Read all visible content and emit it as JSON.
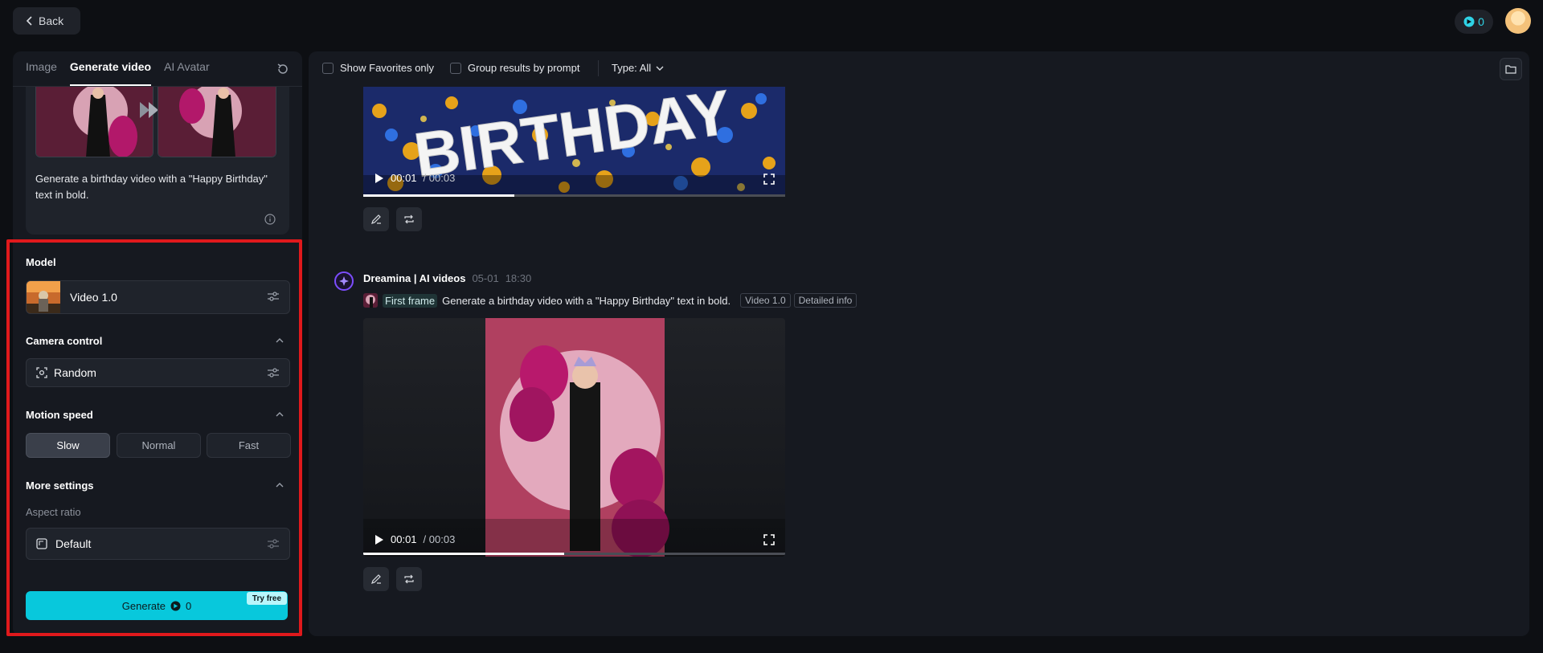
{
  "topbar": {
    "back_label": "Back",
    "credits": "0"
  },
  "tabs": [
    {
      "label": "Image"
    },
    {
      "label": "Generate video"
    },
    {
      "label": "AI Avatar"
    }
  ],
  "prompt_card": {
    "text": "Generate a birthday video with a \"Happy Birthday\" text in bold."
  },
  "model": {
    "label": "Model",
    "value": "Video 1.0"
  },
  "camera": {
    "label": "Camera control",
    "value": "Random"
  },
  "motion": {
    "label": "Motion speed",
    "options": [
      {
        "label": "Slow"
      },
      {
        "label": "Normal"
      },
      {
        "label": "Fast"
      }
    ],
    "selected": "Slow"
  },
  "more_settings": {
    "label": "More settings",
    "aspect_label": "Aspect ratio",
    "aspect_value": "Default"
  },
  "generate": {
    "label": "Generate",
    "cost": "0",
    "badge": "Try free"
  },
  "filters": {
    "favorites": "Show Favorites only",
    "group": "Group results by prompt",
    "type": "Type: All"
  },
  "video1": {
    "time": "00:01",
    "duration": "/ 00:03",
    "overlay_text": "BIRTHDAY"
  },
  "message": {
    "author": "Dreamina | AI videos",
    "date": "05-01",
    "time": "18:30",
    "first_frame": "First frame",
    "prompt": "Generate a birthday video with a \"Happy Birthday\" text in bold.",
    "tags": [
      {
        "label": "Video 1.0"
      },
      {
        "label": "Detailed info"
      }
    ]
  },
  "video2": {
    "time": "00:01",
    "duration": "/ 00:03"
  },
  "colors": {
    "accent": "#08c8dc",
    "highlight": "#e0191c",
    "panel": "#161920",
    "background": "#0d0f13"
  }
}
